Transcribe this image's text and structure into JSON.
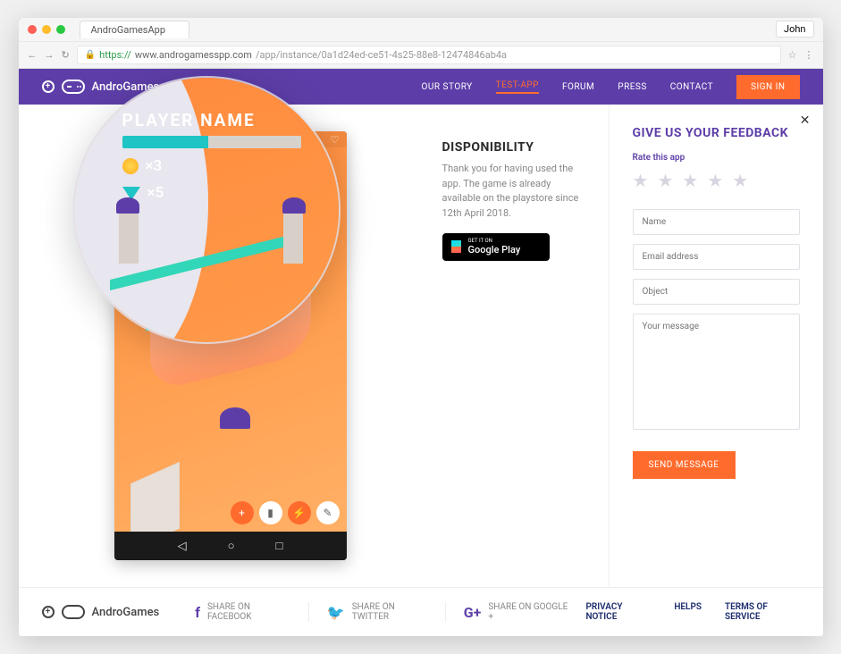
{
  "browser": {
    "tab_title": "AndroGamesApp",
    "user_chip": "John",
    "url_secure": "https://",
    "url_host": "www.androgamesspp.com",
    "url_path": "/app/instance/0a1d24ed-ce51-4s25-88e8-12474846ab4a"
  },
  "nav": {
    "brand": "AndroGames",
    "links": [
      {
        "label": "OUR STORY",
        "active": false
      },
      {
        "label": "TEST-APP",
        "active": true
      },
      {
        "label": "FORUM",
        "active": false
      },
      {
        "label": "PRESS",
        "active": false
      },
      {
        "label": "CONTACT",
        "active": false
      }
    ],
    "signin": "SIGN IN"
  },
  "game": {
    "player_label": "PLAYER NAME",
    "coins": "×3",
    "gems": "×5"
  },
  "mid": {
    "title": "DISPONIBILITY",
    "text": "Thank you for having used the app. The game is already available on the playstore since 12th April 2018.",
    "gplay_small": "GET IT ON",
    "gplay_big": "Google Play"
  },
  "feedback": {
    "title": "GIVE US YOUR FEEDBACK",
    "rate_label": "Rate this app",
    "name_ph": "Name",
    "email_ph": "Email address",
    "object_ph": "Object",
    "message_ph": "Your message",
    "send": "SEND MESSAGE"
  },
  "footer": {
    "brand": "AndroGames",
    "fb": "SHARE ON FACEBOOK",
    "tw": "SHARE ON TWITTER",
    "gp": "SHARE ON GOOGLE +",
    "privacy": "PRIVACY NOTICE",
    "helps": "HELPS",
    "tos": "TERMS OF SERVICE"
  }
}
